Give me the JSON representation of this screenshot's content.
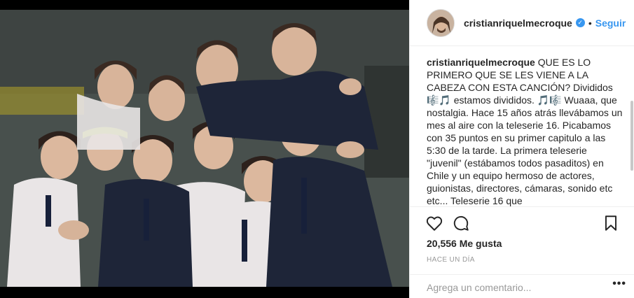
{
  "post": {
    "image_alt": "group-photo",
    "username": "cristianriquelmecroque",
    "verified_icon": "verified-badge-icon",
    "separator": "•",
    "follow_label": "Seguir",
    "caption_text": " QUE ES LO PRIMERO QUE SE LES VIENE A LA CABEZA CON ESTA CANCIÓN? Divididos 🎼🎵 estamos divididos. 🎵🎼 Wuaaa, que nostalgia. Hace 15 años atrás llevábamos un mes al aire con la teleserie 16. Picabamos con 35 puntos en su primer capitulo a las 5:30 de la tarde. La primera teleserie \"juvenil\" (estábamos todos pasaditos) en Chile y un equipo hermoso de actores, guionistas, directores, cámaras, sonido etc etc... Teleserie 16 que",
    "likes": "20,556 Me gusta",
    "timestamp": "HACE UN DÍA",
    "comment_placeholder": "Agrega un comentario...",
    "more_label": "•••"
  },
  "icons": {
    "like": "heart-icon",
    "comment": "comment-bubble-icon",
    "save": "bookmark-icon"
  },
  "colors": {
    "accent": "#3897f0",
    "text": "#262626",
    "muted": "#999999",
    "border": "#efefef"
  }
}
